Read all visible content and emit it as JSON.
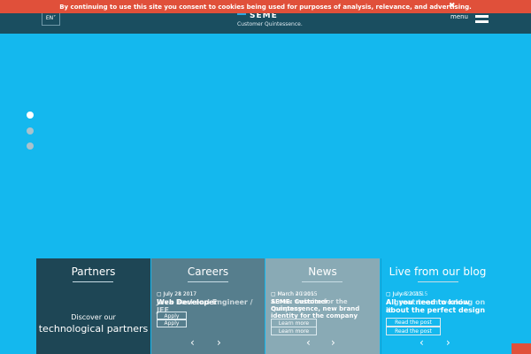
{
  "cookie_bar": {
    "text": "By continuing to use this site you consent to cookies being used for purposes of analysis, relevance, and advertising.",
    "close": "✖"
  },
  "header": {
    "lang": "EN",
    "logo": "SEME",
    "tagline": "Customer Quintessence.",
    "menu_label": "menu"
  },
  "slider": {
    "dots": 3,
    "active": 0
  },
  "panels": {
    "partners": {
      "title": "Partners",
      "subtitle": "Discover our",
      "main": "technological partners"
    },
    "careers": {
      "title": "Careers",
      "date_a": "July 28 2017",
      "date_b": "July 21 2017",
      "title_a": "Web Developer",
      "title_b": "Java Backend Engineer / JEE",
      "apply_a": "Apply",
      "apply_b": "Apply",
      "prev": "‹",
      "next": "›"
    },
    "news": {
      "title": "News",
      "date_a": "March 20 2015",
      "date_b": "March 4 2015",
      "title_a": "SEME: Customer Quintessence, new brand identity for the company",
      "title_b": "A new website for the company",
      "button_a": "Learn more",
      "button_b": "Learn more",
      "prev": "‹",
      "next": "›"
    },
    "blog": {
      "title": "Live from our blog",
      "date_a": "July 8 2015",
      "date_b": "June 23 2015",
      "title_a": "All you need to know about the perfect design",
      "title_b": "A great team working on it",
      "button_a": "Read the post",
      "button_b": "Read the post",
      "prev": "‹",
      "next": "›"
    }
  },
  "colors": {
    "hero": "#14b8ee",
    "header": "#1a4e60",
    "cookie": "#e0503a",
    "partners": "#1e4655",
    "careers": "#567e8d",
    "news": "#89aab5"
  }
}
